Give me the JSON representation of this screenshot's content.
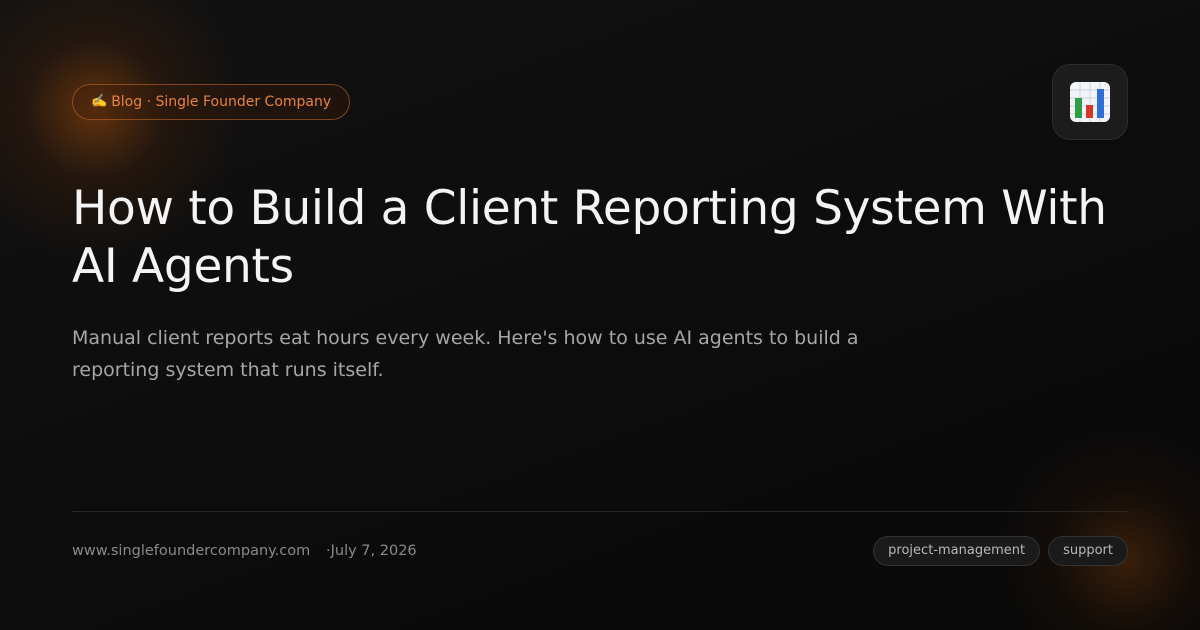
{
  "category_pill": {
    "emoji": "✍️",
    "label": "Blog · Single Founder Company"
  },
  "icon": {
    "name": "bar-chart-icon",
    "colors": [
      "#2e9e44",
      "#d6372b",
      "#2f6fd6"
    ]
  },
  "title": "How to Build a Client Reporting System With AI Agents",
  "description": "Manual client reports eat hours every week. Here's how to use AI agents to build a reporting system that runs itself.",
  "footer": {
    "url": "www.singlefoundercompany.com",
    "date": "·July 7, 2026",
    "tags": [
      "project-management",
      "support"
    ]
  },
  "colors": {
    "accent": "#e8823a",
    "background": "#0b0b0b",
    "title": "#f4f4f4",
    "muted": "#a6a6a6"
  }
}
